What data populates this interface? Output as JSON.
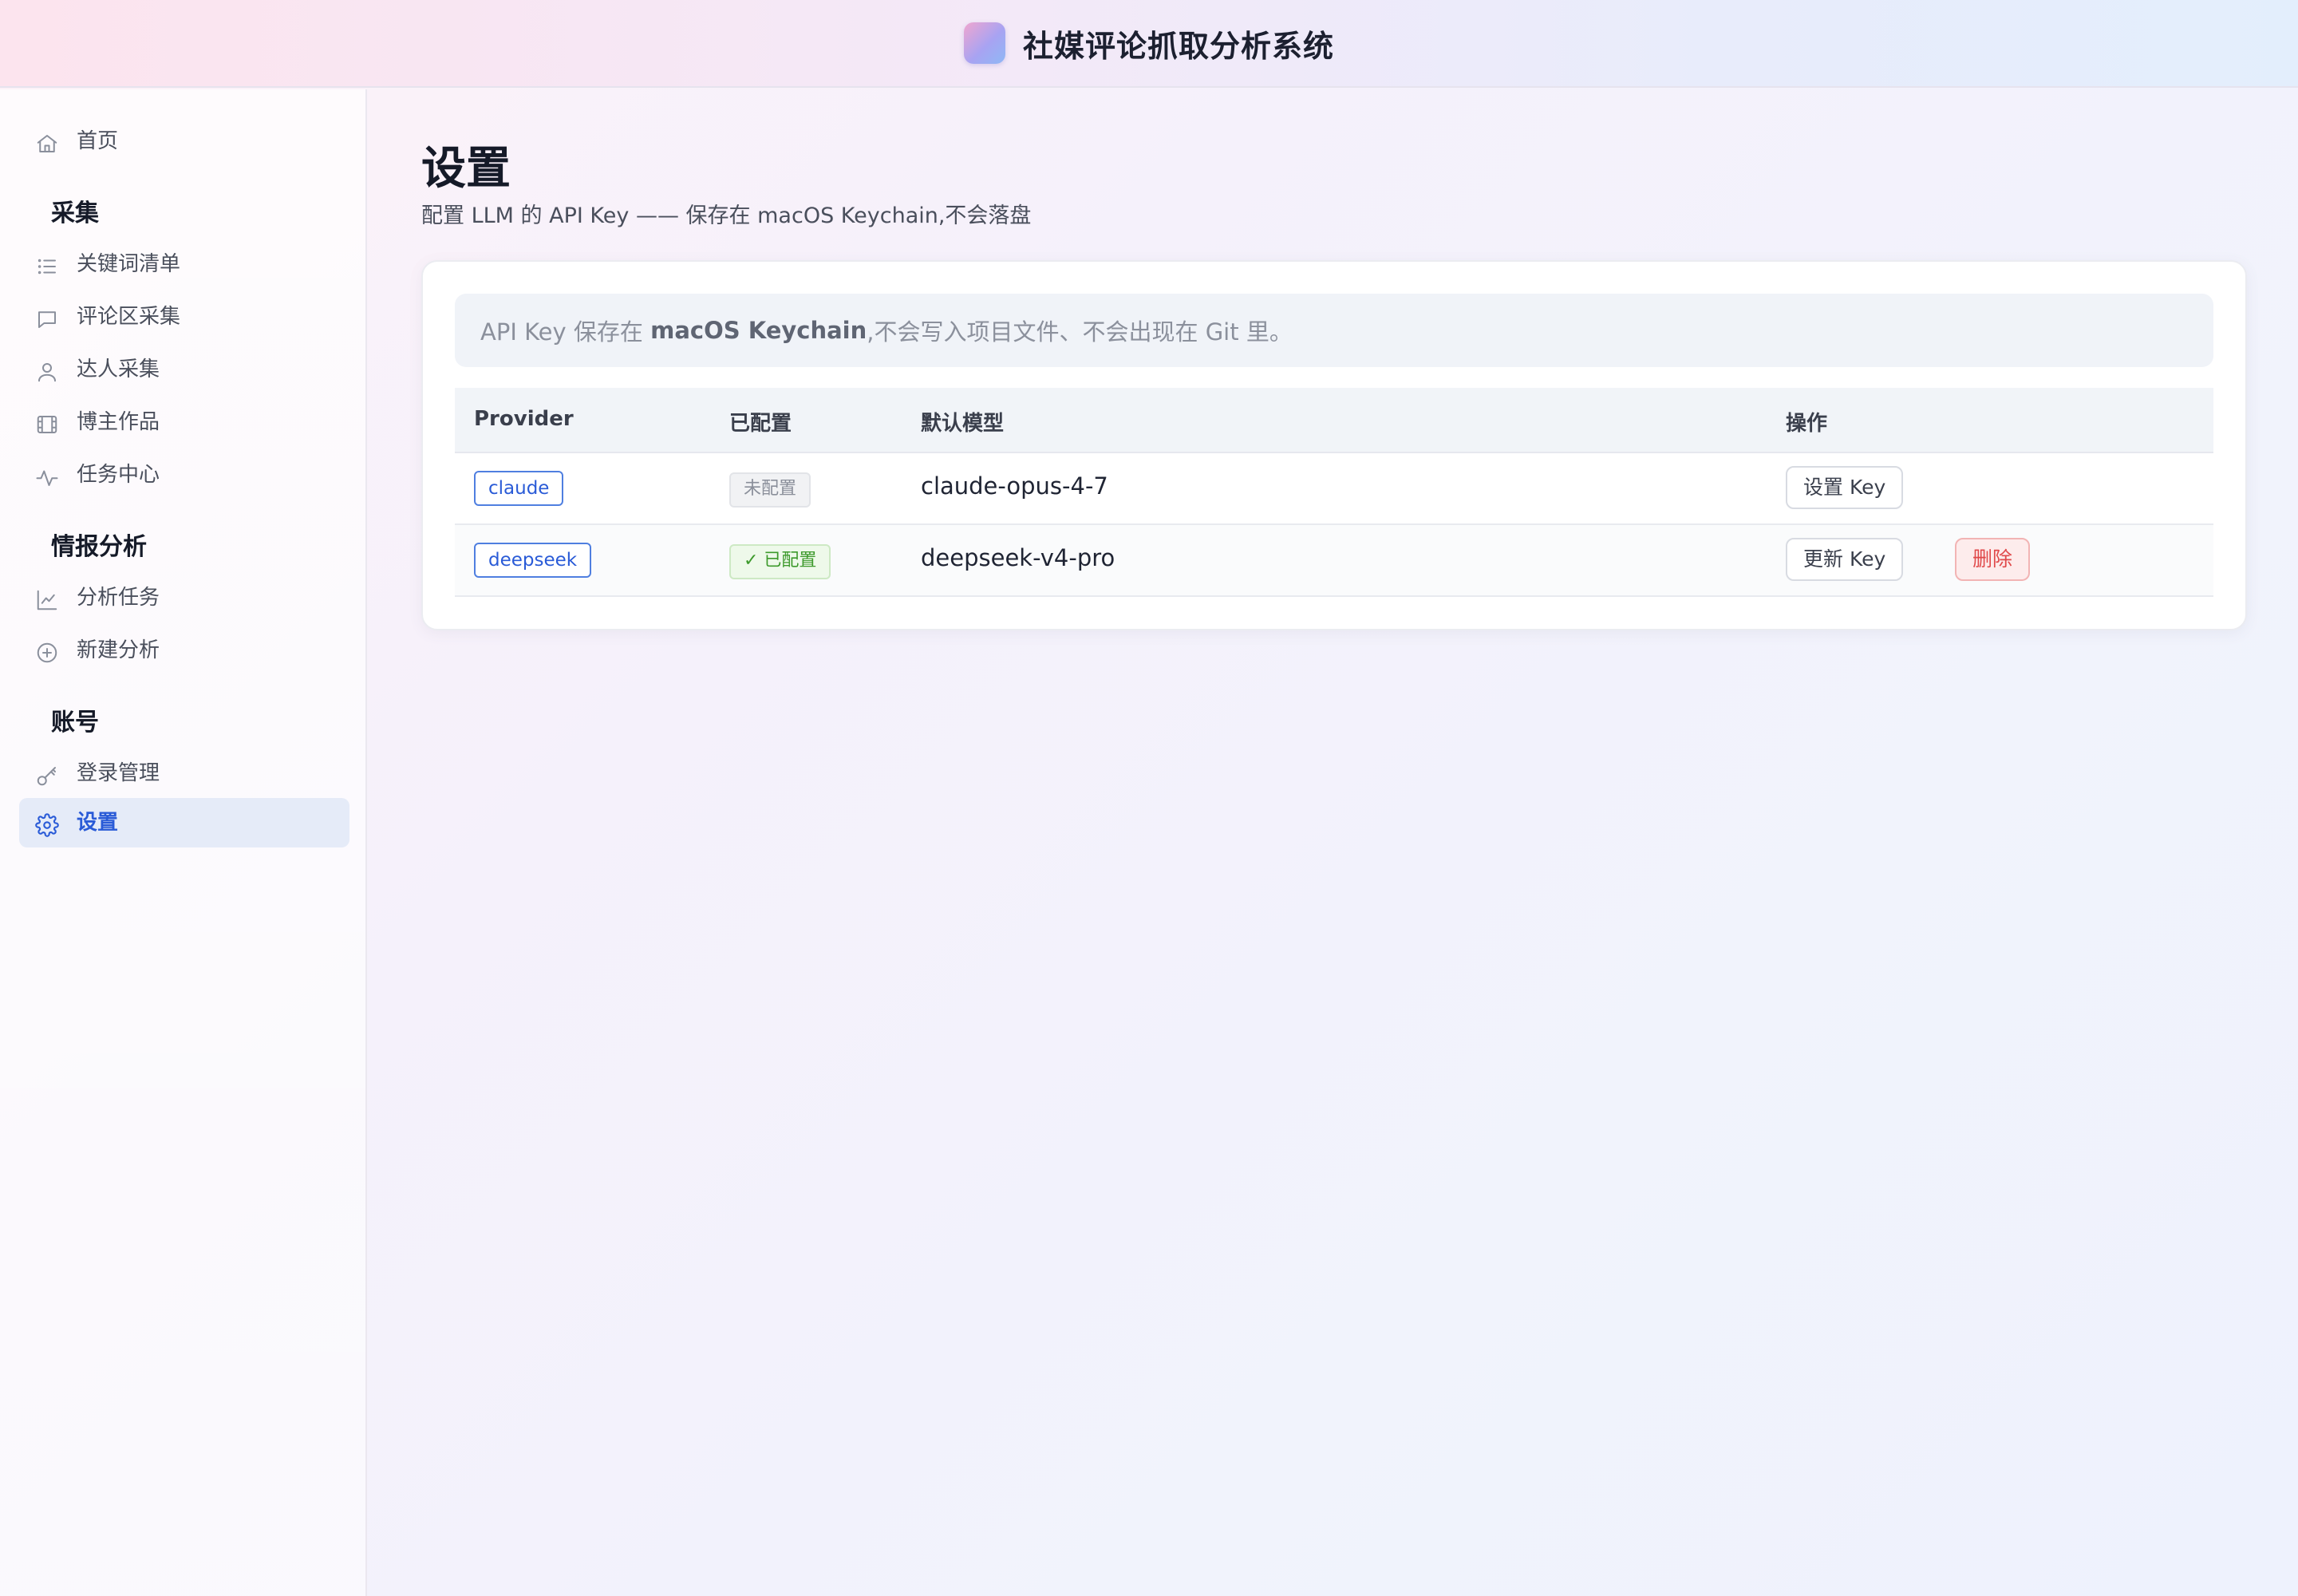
{
  "app": {
    "title": "社媒评论抓取分析系统"
  },
  "sidebar": {
    "home": {
      "label": "首页",
      "icon": "home-icon"
    },
    "groups": [
      {
        "title": "采集",
        "items": [
          {
            "label": "关键词清单",
            "icon": "list-icon"
          },
          {
            "label": "评论区采集",
            "icon": "comment-icon"
          },
          {
            "label": "达人采集",
            "icon": "user-icon"
          },
          {
            "label": "博主作品",
            "icon": "film-icon"
          },
          {
            "label": "任务中心",
            "icon": "activity-icon"
          }
        ]
      },
      {
        "title": "情报分析",
        "items": [
          {
            "label": "分析任务",
            "icon": "chart-line-icon"
          },
          {
            "label": "新建分析",
            "icon": "plus-circle-icon"
          }
        ]
      },
      {
        "title": "账号",
        "items": [
          {
            "label": "登录管理",
            "icon": "key-icon"
          },
          {
            "label": "设置",
            "icon": "gear-icon",
            "active": true
          }
        ]
      }
    ]
  },
  "page": {
    "title": "设置",
    "description": "配置 LLM 的 API Key —— 保存在 macOS Keychain,不会落盘"
  },
  "notice": {
    "prefix": "API Key 保存在 ",
    "emphasis": "macOS Keychain",
    "suffix": ",不会写入项目文件、不会出现在 Git 里。"
  },
  "table": {
    "headers": [
      "Provider",
      "已配置",
      "默认模型",
      "操作"
    ],
    "rows": [
      {
        "provider": "claude",
        "status": "未配置",
        "configured": false,
        "model": "claude-opus-4-7",
        "actions": [
          "设置 Key"
        ]
      },
      {
        "provider": "deepseek",
        "status": "✓ 已配置",
        "configured": true,
        "model": "deepseek-v4-pro",
        "actions": [
          "更新 Key",
          "删除"
        ]
      }
    ]
  },
  "colors": {
    "accent": "#2a5bd7",
    "success": "#3d9a2c",
    "danger": "#e0494a"
  }
}
